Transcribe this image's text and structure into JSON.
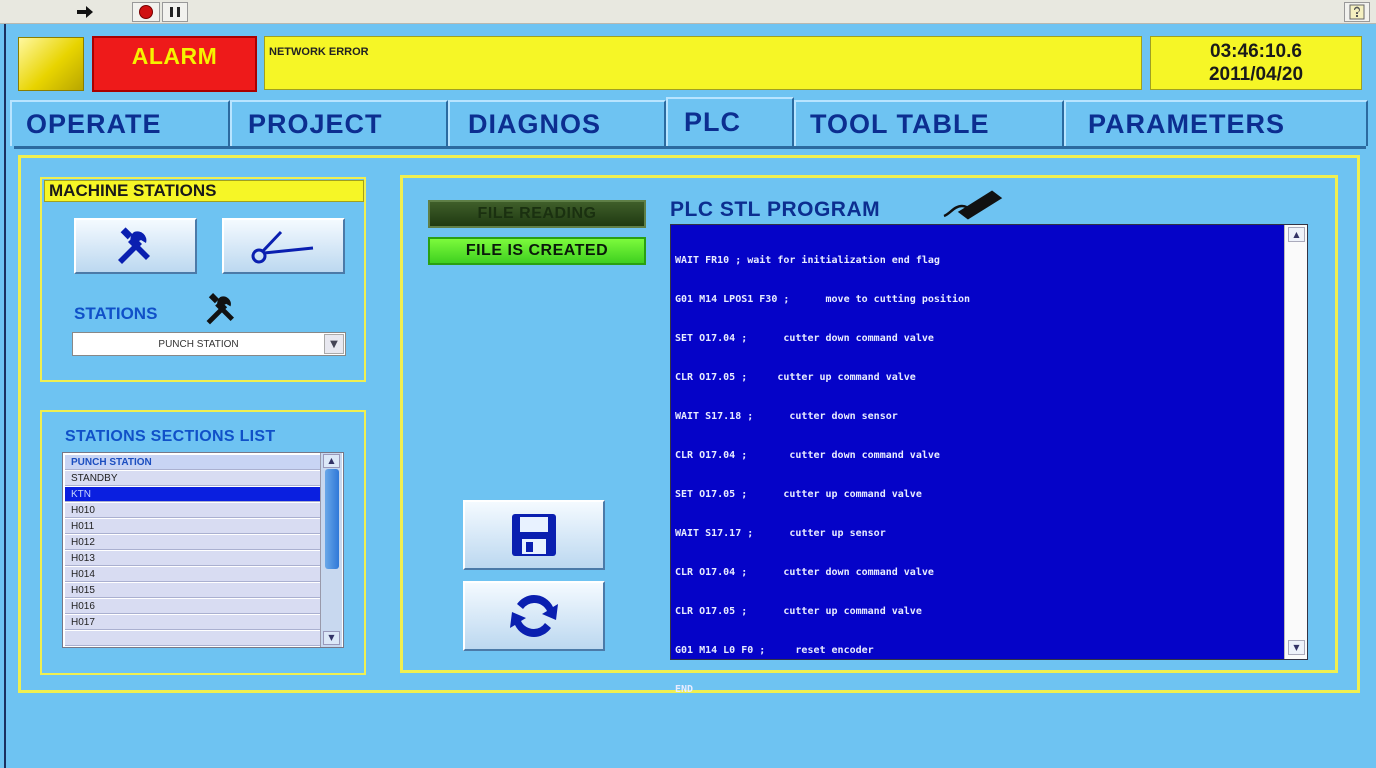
{
  "alarm": {
    "label": "ALARM",
    "message": "NETWORK ERROR"
  },
  "clock": {
    "time": "03:46:10.6",
    "date": "2011/04/20"
  },
  "tabs": [
    {
      "label": "OPERATE",
      "active": false
    },
    {
      "label": "PROJECT",
      "active": false
    },
    {
      "label": "DIAGNOS",
      "active": false
    },
    {
      "label": "PLC",
      "active": true
    },
    {
      "label": "TOOL TABLE",
      "active": false
    },
    {
      "label": "PARAMETERS",
      "active": false
    }
  ],
  "machine_stations": {
    "title": "MACHINE STATIONS",
    "stations_label": "STATIONS",
    "selected_station": "PUNCH STATION"
  },
  "sections_list": {
    "title": "STATIONS SECTIONS LIST",
    "items": [
      "PUNCH STATION",
      "STANDBY",
      "KTN",
      "H010",
      "H011",
      "H012",
      "H013",
      "H014",
      "H015",
      "H016",
      "H017"
    ],
    "selected_index": 2
  },
  "file_status": {
    "reading": "FILE READING",
    "created": "FILE IS CREATED"
  },
  "plc": {
    "title": "PLC STL PROGRAM",
    "lines": [
      "WAIT FR10 ; wait for initialization end flag",
      "G01 M14 LPOS1 F30 ;      move to cutting position",
      "SET O17.04 ;      cutter down command valve",
      "CLR O17.05 ;     cutter up command valve",
      "WAIT S17.18 ;      cutter down sensor",
      "CLR O17.04 ;       cutter down command valve",
      "SET O17.05 ;      cutter up command valve",
      "WAIT S17.17 ;      cutter up sensor",
      "CLR O17.04 ;      cutter down command valve",
      "CLR O17.05 ;      cutter up command valve",
      "G01 M14 L0 F0 ;     reset encoder",
      "END"
    ]
  },
  "colors": {
    "background": "#6ec3f2",
    "panel_border": "#f0ef50",
    "alarm": "#ee1a1a",
    "code_bg": "#0503c8",
    "tab_text": "#0c2e90"
  },
  "icons": [
    "arrow-right-icon",
    "abort-icon",
    "pause-icon",
    "help-icon",
    "tools-icon",
    "scissors-icon",
    "save-disk-icon",
    "refresh-icon",
    "pen-icon"
  ]
}
